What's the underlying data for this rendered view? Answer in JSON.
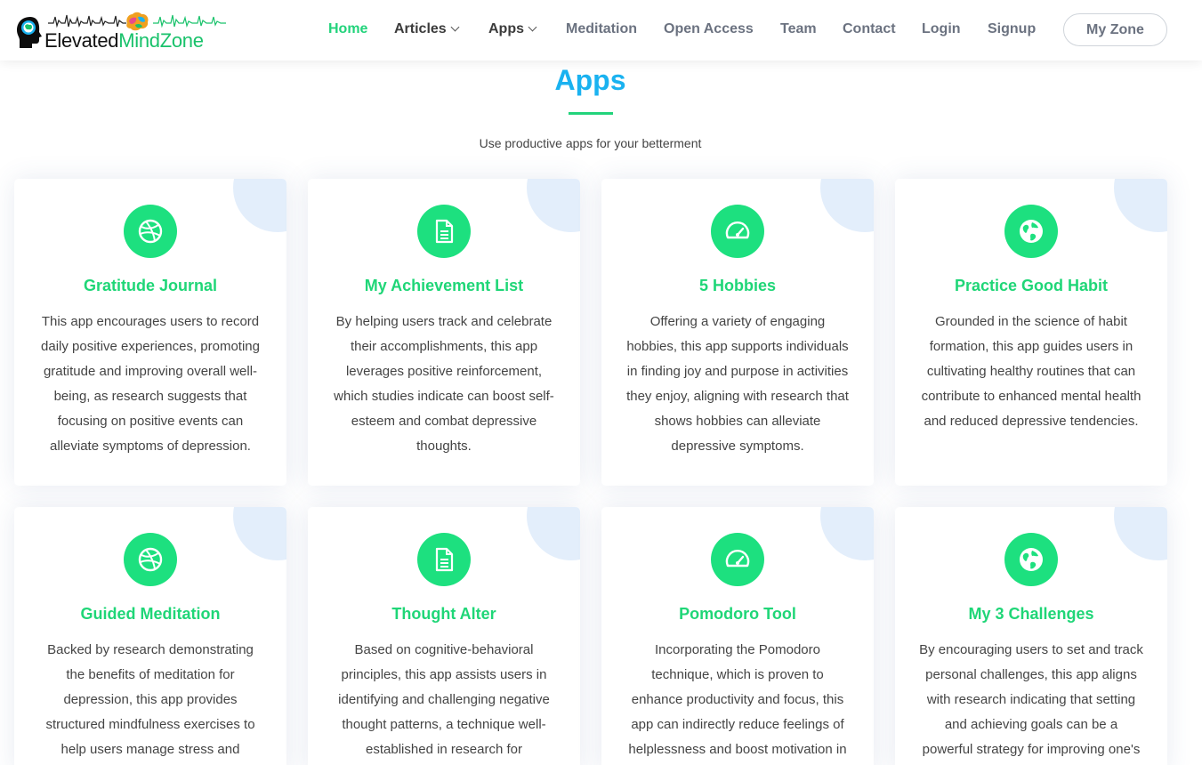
{
  "brand": {
    "name_part1": "Elevated",
    "name_part2": "MindZone"
  },
  "nav": {
    "items": [
      {
        "label": "Home",
        "active": true,
        "dropdown": false
      },
      {
        "label": "Articles",
        "active": false,
        "dropdown": true
      },
      {
        "label": "Apps",
        "active": false,
        "dropdown": true
      },
      {
        "label": "Meditation",
        "active": false,
        "dropdown": false
      },
      {
        "label": "Open Access",
        "active": false,
        "dropdown": false
      },
      {
        "label": "Team",
        "active": false,
        "dropdown": false
      },
      {
        "label": "Contact",
        "active": false,
        "dropdown": false
      },
      {
        "label": "Login",
        "active": false,
        "dropdown": false
      },
      {
        "label": "Signup",
        "active": false,
        "dropdown": false
      }
    ],
    "cta_label": "My Zone"
  },
  "section": {
    "title": "Apps",
    "subtitle": "Use productive apps for your betterment"
  },
  "cards": [
    {
      "icon": "dribbble-icon",
      "title": "Gratitude Journal",
      "description": "This app encourages users to record daily positive experiences, promoting gratitude and improving overall well-being, as research suggests that focusing on positive events can alleviate symptoms of depression."
    },
    {
      "icon": "document-icon",
      "title": "My Achievement List",
      "description": "By helping users track and celebrate their accomplishments, this app leverages positive reinforcement, which studies indicate can boost self-esteem and combat depressive thoughts."
    },
    {
      "icon": "speedometer-icon",
      "title": "5 Hobbies",
      "description": "Offering a variety of engaging hobbies, this app supports individuals in finding joy and purpose in activities they enjoy, aligning with research that shows hobbies can alleviate depressive symptoms."
    },
    {
      "icon": "globe-icon",
      "title": "Practice Good Habit",
      "description": "Grounded in the science of habit formation, this app guides users in cultivating healthy routines that can contribute to enhanced mental health and reduced depressive tendencies."
    },
    {
      "icon": "dribbble-icon",
      "title": "Guided Meditation",
      "description": "Backed by research demonstrating the benefits of meditation for depression, this app provides structured mindfulness exercises to help users manage stress and"
    },
    {
      "icon": "document-icon",
      "title": "Thought Alter",
      "description": "Based on cognitive-behavioral principles, this app assists users in identifying and challenging negative thought patterns, a technique well-established in research for"
    },
    {
      "icon": "speedometer-icon",
      "title": "Pomodoro Tool",
      "description": "Incorporating the Pomodoro technique, which is proven to enhance productivity and focus, this app can indirectly reduce feelings of helplessness and boost motivation in"
    },
    {
      "icon": "globe-icon",
      "title": "My 3 Challenges",
      "description": "By encouraging users to set and track personal challenges, this app aligns with research indicating that setting and achieving goals can be a powerful strategy for improving one's"
    }
  ],
  "colors": {
    "accent_green": "#22d37b",
    "title_blue": "#1ab2f0",
    "icon_bg": "#1de07f",
    "corner_blue": "#e3eefb"
  }
}
